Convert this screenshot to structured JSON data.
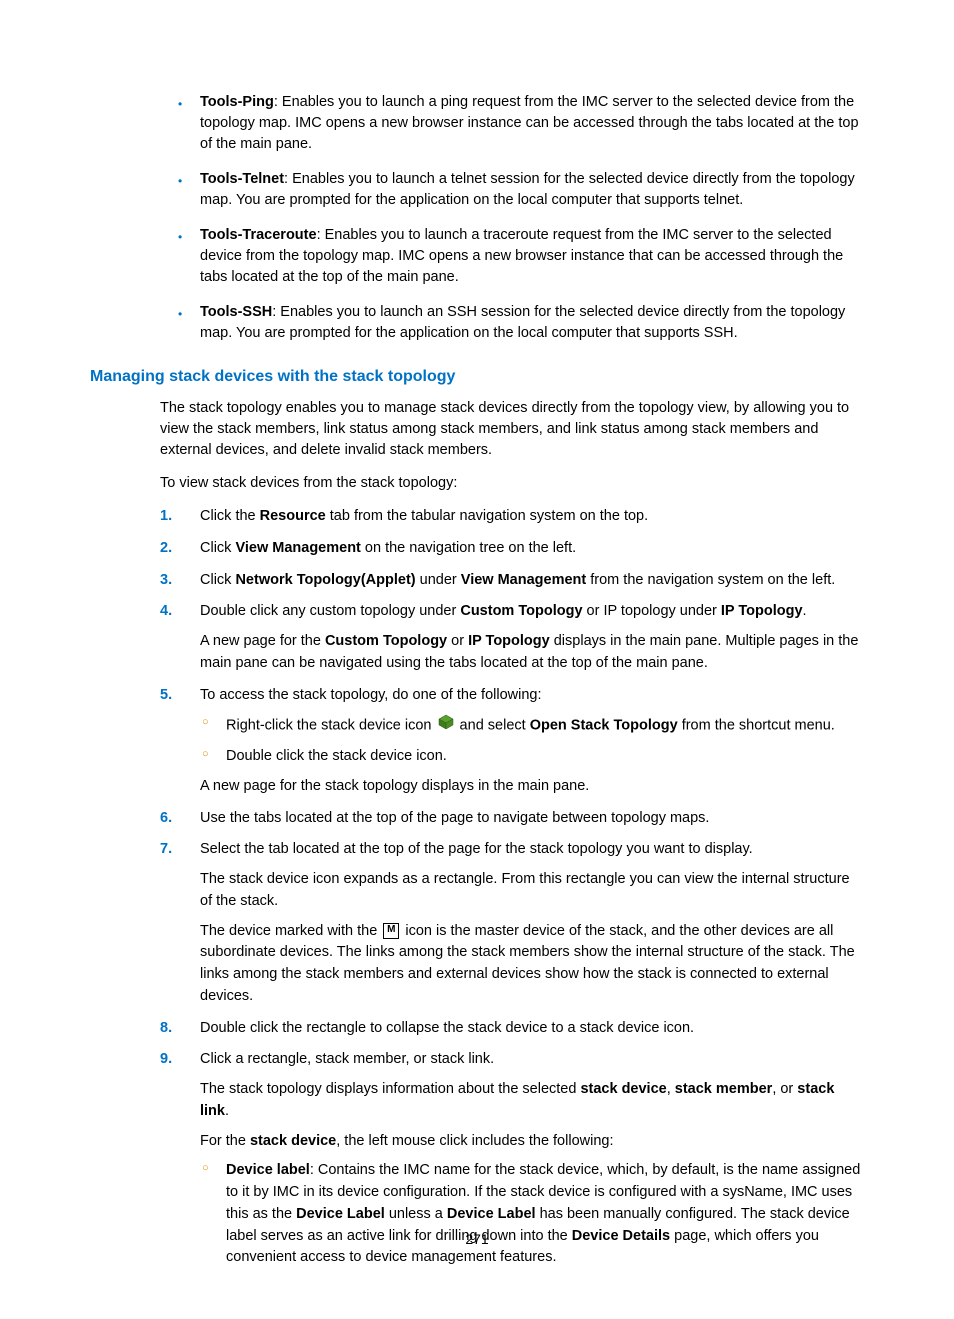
{
  "bullets": [
    {
      "term": "Tools-Ping",
      "desc": ": Enables you to launch a ping request from the IMC server to the selected device from the topology map. IMC opens a new browser instance can be accessed through the tabs located at the top of the main pane."
    },
    {
      "term": "Tools-Telnet",
      "desc": ": Enables you to launch a telnet session for the selected device directly from the topology map. You are prompted for the application on the local computer that supports telnet."
    },
    {
      "term": "Tools-Traceroute",
      "desc": ": Enables you to launch a traceroute request from the IMC server to the selected device from the topology map. IMC opens a new browser instance that can be accessed through the tabs located at the top of the main pane."
    },
    {
      "term": "Tools-SSH",
      "desc": ": Enables you to launch an SSH session for the selected device directly from the topology map. You are prompted for the application on the local computer that supports SSH."
    }
  ],
  "heading": "Managing stack devices with the stack topology",
  "intro": "The stack topology enables you to manage stack devices directly from the topology view, by allowing you to view the stack members, link status among stack members, and link status among stack members and external devices, and delete invalid stack members.",
  "lead": "To view stack devices from the stack topology:",
  "step1": {
    "pre": "Click the ",
    "b1": "Resource",
    "post": " tab from the tabular navigation system on the top."
  },
  "step2": {
    "pre": "Click ",
    "b1": "View Management",
    "post": " on the navigation tree on the left."
  },
  "step3": {
    "pre": "Click ",
    "b1": "Network Topology(Applet)",
    "mid": " under ",
    "b2": "View Management",
    "post": " from the navigation system on the left."
  },
  "step4": {
    "pre": "Double click any custom topology under ",
    "b1": "Custom Topology",
    "mid": " or IP topology under ",
    "b2": "IP Topology",
    "post": ".",
    "extra_pre": "A new page for the ",
    "extra_b1": "Custom Topology",
    "extra_mid": " or ",
    "extra_b2": "IP Topology",
    "extra_post": " displays in the main pane. Multiple pages in the main pane can be navigated using the tabs located at the top of the main pane."
  },
  "step5": {
    "text": "To access the stack topology, do one of the following:",
    "sub1_pre": "Right-click the stack device icon ",
    "sub1_mid": " and select ",
    "sub1_b": "Open Stack Topology",
    "sub1_post": " from the shortcut menu.",
    "sub2": "Double click the stack device icon.",
    "extra": "A new page for the stack topology displays in the main pane."
  },
  "step6": "Use the tabs located at the top of the page to navigate between topology maps.",
  "step7": {
    "text": "Select the tab located at the top of the page for the stack topology you want to display.",
    "extra1": "The stack device icon expands as a rectangle. From this rectangle you can view the internal structure of the stack.",
    "extra2_pre": "The device marked with the ",
    "extra2_post": " icon is the master device of the stack, and the other devices are all subordinate devices. The links among the stack members show the internal structure of the stack. The links among the stack members and external devices show how the stack is connected to external devices."
  },
  "step8": "Double click the rectangle to collapse the stack device to a stack device icon.",
  "step9": {
    "text": "Click a rectangle, stack member, or stack link.",
    "extra1_pre": "The stack topology displays information about the selected ",
    "extra1_b1": "stack device",
    "extra1_mid1": ", ",
    "extra1_b2": "stack member",
    "extra1_mid2": ", or ",
    "extra1_b3": "stack link",
    "extra1_post": ".",
    "extra2_pre": "For the ",
    "extra2_b": "stack device",
    "extra2_post": ", the left mouse click includes the following:",
    "sub1_b1": "Device label",
    "sub1_t1": ": Contains the IMC name for the stack device, which, by default, is the name assigned to it by IMC in its device configuration. If the stack device is configured with a sysName, IMC uses this as the ",
    "sub1_b2": "Device Label",
    "sub1_t2": " unless a ",
    "sub1_b3": "Device Label",
    "sub1_t3": " has been manually configured. The stack device label serves as an active link for drilling down into the ",
    "sub1_b4": "Device Details",
    "sub1_t4": " page, which offers you convenient access to device management features."
  },
  "icon_m_label": "M",
  "page_number": "271"
}
